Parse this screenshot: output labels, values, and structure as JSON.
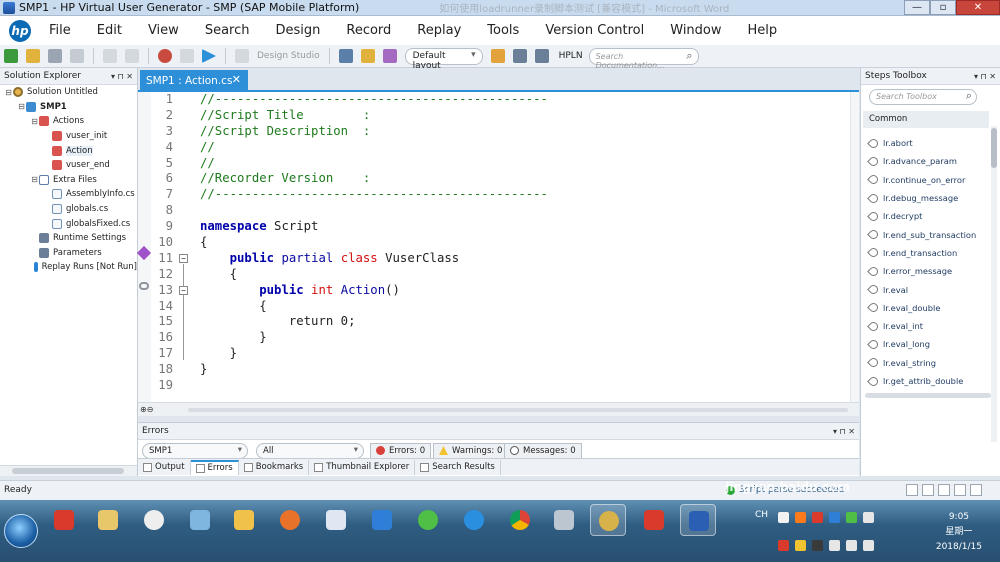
{
  "window": {
    "title": "SMP1 - HP Virtual User Generator - SMP (SAP Mobile Platform)",
    "background_title": "如何使用loadrunner录制脚本测试 [兼容模式] - Microsoft Word",
    "buttons": [
      "—",
      "▫",
      "✕"
    ]
  },
  "menu": [
    "File",
    "Edit",
    "View",
    "Search",
    "Design",
    "Record",
    "Replay",
    "Tools",
    "Version Control",
    "Window",
    "Help"
  ],
  "toolbar": {
    "design_studio": "Design Studio",
    "layout": "Default layout",
    "hpln": "HPLN",
    "search_placeholder": "Search Documentation..."
  },
  "solution_explorer": {
    "title": "Solution Explorer",
    "items": [
      {
        "label": "Solution Untitled",
        "level": 0,
        "icon": "solution-icon",
        "toggle": "⊟"
      },
      {
        "label": "SMP1",
        "level": 1,
        "icon": "project-icon",
        "toggle": "⊟",
        "bold": true
      },
      {
        "label": "Actions",
        "level": 2,
        "icon": "actions-icon",
        "toggle": "⊟"
      },
      {
        "label": "vuser_init",
        "level": 3,
        "icon": "action-icon",
        "toggle": ""
      },
      {
        "label": "Action",
        "level": 3,
        "icon": "action-icon",
        "toggle": "",
        "selected": true
      },
      {
        "label": "vuser_end",
        "level": 3,
        "icon": "action-icon",
        "toggle": ""
      },
      {
        "label": "Extra Files",
        "level": 2,
        "icon": "folder-icon",
        "toggle": "⊟"
      },
      {
        "label": "AssemblyInfo.cs",
        "level": 3,
        "icon": "file-icon",
        "toggle": ""
      },
      {
        "label": "globals.cs",
        "level": 3,
        "icon": "file-icon",
        "toggle": ""
      },
      {
        "label": "globalsFixed.cs",
        "level": 3,
        "icon": "file-icon",
        "toggle": ""
      },
      {
        "label": "Runtime Settings",
        "level": 2,
        "icon": "settings-icon",
        "toggle": ""
      },
      {
        "label": "Parameters",
        "level": 2,
        "icon": "parameters-icon",
        "toggle": ""
      },
      {
        "label": "Replay Runs [Not Run]",
        "level": 2,
        "icon": "replay-icon",
        "toggle": ""
      }
    ]
  },
  "editor": {
    "tab": "SMP1 : Action.cs",
    "tab_close": "✕",
    "line_numbers": [
      "1",
      "2",
      "3",
      "4",
      "5",
      "6",
      "7",
      "8",
      "9",
      "10",
      "11",
      "12",
      "13",
      "14",
      "15",
      "16",
      "17",
      "18",
      "19"
    ],
    "lines": [
      [
        {
          "t": "//---------------------------------------------",
          "c": "cmt"
        }
      ],
      [
        {
          "t": "//Script Title        :",
          "c": "cmt"
        }
      ],
      [
        {
          "t": "//Script Description  :",
          "c": "cmt"
        }
      ],
      [
        {
          "t": "//",
          "c": "cmt"
        }
      ],
      [
        {
          "t": "//",
          "c": "cmt"
        }
      ],
      [
        {
          "t": "//Recorder Version    :",
          "c": "cmt"
        }
      ],
      [
        {
          "t": "//---------------------------------------------",
          "c": "cmt"
        }
      ],
      [],
      [
        {
          "t": "namespace",
          "c": "kw"
        },
        {
          "t": " Script",
          "c": "plain"
        }
      ],
      [
        {
          "t": "{",
          "c": "plain"
        }
      ],
      [
        {
          "t": "    ",
          "c": "plain"
        },
        {
          "t": "public",
          "c": "kw"
        },
        {
          "t": " partial ",
          "c": "kw2"
        },
        {
          "t": "class",
          "c": "red"
        },
        {
          "t": " VuserClass",
          "c": "plain"
        }
      ],
      [
        {
          "t": "    {",
          "c": "plain"
        }
      ],
      [
        {
          "t": "        ",
          "c": "plain"
        },
        {
          "t": "public",
          "c": "kw"
        },
        {
          "t": " int ",
          "c": "red"
        },
        {
          "t": "Action",
          "c": "kw2"
        },
        {
          "t": "()",
          "c": "plain"
        }
      ],
      [
        {
          "t": "        {",
          "c": "plain"
        }
      ],
      [
        {
          "t": "            return 0;",
          "c": "plain"
        }
      ],
      [
        {
          "t": "        }",
          "c": "plain"
        }
      ],
      [
        {
          "t": "    }",
          "c": "plain"
        }
      ],
      [
        {
          "t": "}",
          "c": "plain"
        }
      ],
      []
    ],
    "zoom": "⊕⊖"
  },
  "errors_panel": {
    "title": "Errors",
    "script_filter": "SMP1",
    "scope_filter": "All",
    "errors": "Errors: 0",
    "warnings": "Warnings: 0",
    "messages": "Messages: 0"
  },
  "bottom_tabs": [
    "Output",
    "Errors",
    "Bookmarks",
    "Thumbnail Explorer",
    "Search Results"
  ],
  "steps_toolbox": {
    "title": "Steps Toolbox",
    "search_placeholder": "Search Toolbox",
    "category": "Common",
    "items": [
      "lr.abort",
      "lr.advance_param",
      "lr.continue_on_error",
      "lr.debug_message",
      "lr.decrypt",
      "lr.end_sub_transaction",
      "lr.end_transaction",
      "lr.error_message",
      "lr.eval",
      "lr.eval_double",
      "lr.eval_int",
      "lr.eval_long",
      "lr.eval_string",
      "lr.get_attrib_double"
    ]
  },
  "status": {
    "ready": "Ready",
    "script_status": "Script parse succeeded"
  },
  "taskbar": {
    "ime": "CH",
    "time": "9:05",
    "weekday": "星期一",
    "date": "2018/1/15",
    "watermark": "jingyan.baidu.com"
  },
  "colors": {
    "accent": "#2d8fd8",
    "comment": "#1e7a1e",
    "keyword": "#0000aa",
    "type_keyword": "#d31010"
  }
}
